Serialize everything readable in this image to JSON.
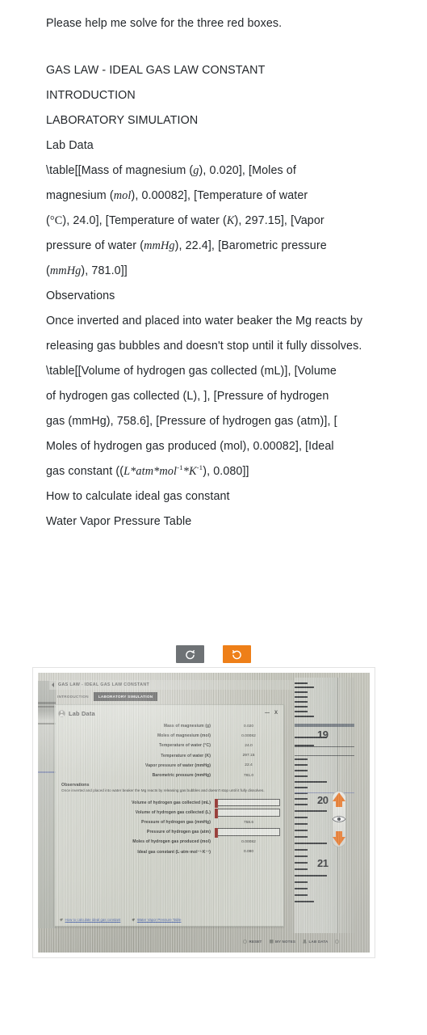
{
  "question": {
    "prompt": "Please help me solve for the three red boxes.",
    "heading": "GAS LAW  -  IDEAL GAS LAW CONSTANT",
    "section_intro": "INTRODUCTION",
    "section_sim": "LABORATORY SIMULATION",
    "lab_data_label": "Lab Data",
    "observations_label": "Observations",
    "observations_text": "Once inverted and placed into water beaker the Mg reacts by releasing gas bubbles and doesn't stop until it fully dissolves.",
    "link_how_to": "How to calculate ideal gas constant",
    "link_vapor_table": "Water Vapor Pressure Table",
    "table1_prefix": "\\table[[Mass of magnesium (",
    "table1_line1_a": "), 0.020], [Moles of",
    "table1_line2_a": "magnesium (",
    "table1_line2_b": "), 0.00082], [Temperature of water",
    "table1_line3_a": "), 24.0], [Temperature of water (",
    "table1_line3_b": "), 297.15], [Vapor",
    "table1_line4_a": "pressure of water (",
    "table1_line4_b": "), 22.4], [Barometric pressure",
    "table1_line5_a": "), 781.0]]",
    "table2_line1": "\\table[[Volume of hydrogen gas collected (mL)], [Volume",
    "table2_line2": "of hydrogen gas collected (L), ], [Pressure of hydrogen",
    "table2_line3": "gas (mmHg), 758.6], [Pressure of hydrogen gas (atm)], [",
    "table2_line4": "Moles of hydrogen gas produced (mol), 0.00082], [Ideal",
    "table2_line5_a": "gas constant (",
    "table2_line5_b": "), 0.080]]",
    "unit_g": "g",
    "unit_mol": "mol",
    "unit_degC": "°C",
    "unit_K": "K",
    "unit_mmHg": "mmHg",
    "gas_const_units": "L*atm*mol",
    "gas_const_units_2": "*K",
    "exp_neg1": "-1"
  },
  "toolbar": {
    "rotate_ccw_label": "rotate-counter-clockwise",
    "rotate_cw_label": "rotate-clockwise",
    "gray_color": "#6e7275",
    "orange_color": "#ee7f18"
  },
  "simulation": {
    "title": "GAS LAW - IDEAL GAS LAW CONSTANT",
    "tabs": [
      {
        "label": "INTRODUCTION",
        "active": false
      },
      {
        "label": "LABORATORY SIMULATION",
        "active": true
      }
    ],
    "card_title": "Lab Data",
    "minimize_label": "—",
    "close_label": "X",
    "lab_rows": [
      {
        "label": "Mass of magnesium (g)",
        "value": "0.020",
        "field": false,
        "red": false
      },
      {
        "label": "Moles of magnesium (mol)",
        "value": "0.00082",
        "field": false,
        "red": false
      },
      {
        "label": "Temperature of water (°C)",
        "value": "24.0",
        "field": false,
        "red": false
      },
      {
        "label": "Temperature of water (K)",
        "value": "297.15",
        "field": false,
        "red": false
      },
      {
        "label": "Vapor pressure of water (mmHg)",
        "value": "22.4",
        "field": false,
        "red": false
      },
      {
        "label": "Barometric pressure (mmHg)",
        "value": "781.0",
        "field": false,
        "red": false
      }
    ],
    "observations_label": "Observations",
    "observations_text": "Once inverted and placed into water beaker the Mg reacts by releasing gas bubbles and doesn't stop until it fully dissolves.",
    "result_rows": [
      {
        "label": "Volume of hydrogen gas collected (mL)",
        "value": "",
        "field": true,
        "red": true
      },
      {
        "label": "Volume of hydrogen gas collected (L)",
        "value": "",
        "field": true,
        "red": true
      },
      {
        "label": "Pressure of hydrogen gas (mmHg)",
        "value": "758.6",
        "field": false,
        "red": false
      },
      {
        "label": "Pressure of hydrogen gas (atm)",
        "value": "",
        "field": true,
        "red": true
      },
      {
        "label": "Moles of hydrogen gas produced (mol)",
        "value": "0.00082",
        "field": false,
        "red": false
      },
      {
        "label": "Ideal gas constant (L·atm·mol⁻¹·K⁻¹)",
        "value": "0.080",
        "field": false,
        "red": false
      }
    ],
    "link_how_to": "How to calculate ideal gas constant",
    "link_vapor_table": "Water Vapor Pressure Table",
    "burette": {
      "numbers": [
        "19",
        "20",
        "21"
      ]
    },
    "bottom_bar": [
      {
        "label": "RESET",
        "icon": "reset-icon"
      },
      {
        "label": "MY NOTES",
        "icon": "notes-icon"
      },
      {
        "label": "LAB DATA",
        "icon": "lab-data-icon"
      }
    ],
    "red_box_color": "#8e1b17"
  }
}
